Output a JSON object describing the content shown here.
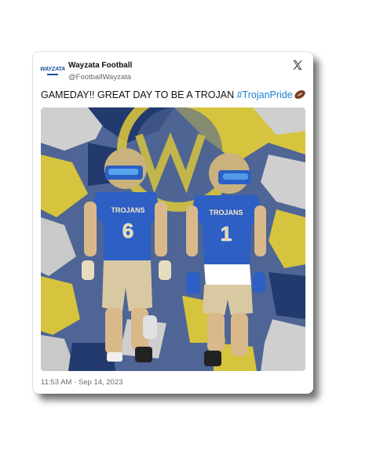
{
  "tweet": {
    "account_name": "Wayzata Football",
    "handle": "@FootballWayzata",
    "avatar_text": "WAYZATA",
    "text": "GAMEDAY!! GREAT DAY TO BE A TROJAN ",
    "hashtag": "#TrojanPride",
    "timestamp": "11:53 AM · Sep 14, 2023",
    "platform_icon": "x-logo-icon"
  },
  "photo": {
    "jersey_label": "TROJANS",
    "players": [
      {
        "number": "6"
      },
      {
        "number": "1"
      }
    ],
    "colors": {
      "jersey_blue": "#2d5fc4",
      "pants_tan": "#d8c9a3",
      "helmet_gold": "#c9b27e",
      "camo_yellow": "#d6c33e",
      "camo_navy": "#233a6e",
      "camo_gray": "#c9c9c9"
    }
  }
}
